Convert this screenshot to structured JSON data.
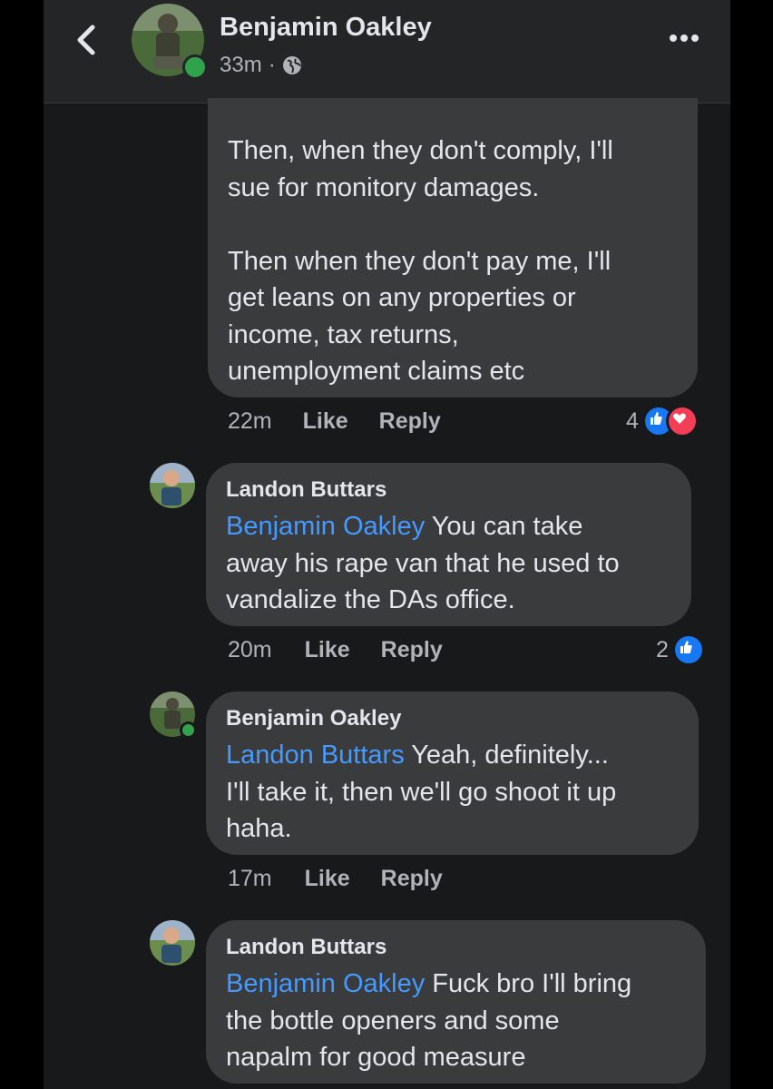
{
  "header": {
    "name": "Benjamin Oakley",
    "time": "33m",
    "separator": "·",
    "back_icon": "chevron-left-icon",
    "menu_icon": "more-dots-icon",
    "privacy_icon": "globe-icon"
  },
  "comments": [
    {
      "text_lines": [
        "Then, when they don't comply, I'll",
        "sue for monitory damages.",
        "",
        "Then when they don't pay me, I'll",
        "get leans on any properties or",
        "income, tax returns,",
        "unemployment claims etc"
      ],
      "time": "22m",
      "like": "Like",
      "reply": "Reply",
      "reaction_count": "4",
      "reactions": [
        "like",
        "love"
      ]
    },
    {
      "author": "Landon Buttars",
      "mention": "Benjamin Oakley",
      "line1_rest": " You can take",
      "line2": "away his rape van that he used to",
      "line3": "vandalize the DAs office.",
      "time": "20m",
      "like": "Like",
      "reply": "Reply",
      "reaction_count": "2",
      "reactions": [
        "like"
      ]
    },
    {
      "author": "Benjamin Oakley",
      "mention": "Landon Buttars",
      "line1_rest": " Yeah, definitely...",
      "line2": "I'll take it, then we'll go shoot it up",
      "line3": "haha.",
      "time": "17m",
      "like": "Like",
      "reply": "Reply"
    },
    {
      "author": "Landon Buttars",
      "mention": "Benjamin Oakley",
      "line1_rest": " Fuck bro I'll bring",
      "line2": "the bottle openers and some",
      "line3": "napalm for good measure"
    }
  ],
  "colors": {
    "background": "#18191a",
    "bubble": "#3a3b3c",
    "mention": "#4599ff",
    "like_blue": "#1877f2",
    "love_red": "#f33e58",
    "online_green": "#31a24c"
  }
}
